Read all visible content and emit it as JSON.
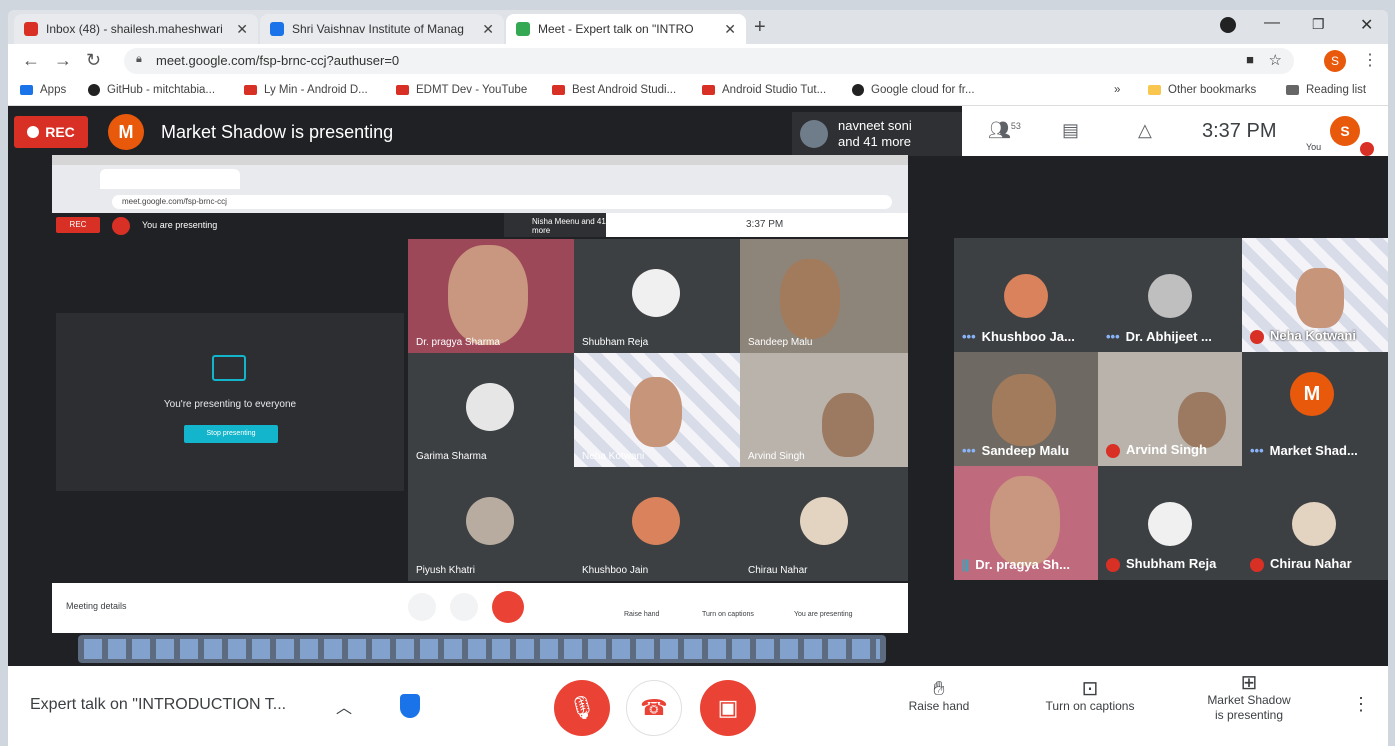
{
  "browser": {
    "tabs": [
      {
        "label": "Inbox (48) - shailesh.maheshwari",
        "color": "#d93025"
      },
      {
        "label": "Shri Vaishnav Institute of Manag",
        "color": "#1a73e8"
      },
      {
        "label": "Meet - Expert talk on \"INTRO",
        "color": "#34a853"
      }
    ],
    "url": "meet.google.com/fsp-brnc-ccj?authuser=0",
    "bookmarks": [
      "Apps",
      "GitHub - mitchtabia...",
      "Ly Min - Android D...",
      "EDMT Dev - YouTube",
      "Best Android Studi...",
      "Android Studio Tut...",
      "Google cloud for fr...",
      "Other bookmarks",
      "Reading list"
    ]
  },
  "meet": {
    "rec_label": "REC",
    "presenter_initial": "M",
    "presenting_title": "Market Shadow is presenting",
    "viewer_line1": "navneet soni",
    "viewer_line2": "and 41 more",
    "people_count": "53",
    "time": "3:37 PM",
    "you_label": "You",
    "you_initial": "S",
    "tiles": [
      {
        "name": "Khushboo Ja...",
        "muted": false
      },
      {
        "name": "Dr. Abhijeet ...",
        "muted": false
      },
      {
        "name": "Neha Kotwani",
        "muted": true
      },
      {
        "name": "Sandeep Malu",
        "muted": false
      },
      {
        "name": "Arvind Singh",
        "muted": true
      },
      {
        "name": "Market Shad...",
        "muted": false,
        "initial": "M"
      },
      {
        "name": "Dr. pragya Sh...",
        "muted": false
      },
      {
        "name": "Shubham Reja",
        "muted": true
      },
      {
        "name": "Chirau Nahar",
        "muted": true
      }
    ]
  },
  "inner": {
    "url": "meet.google.com/fsp-brnc-ccj",
    "rec_label": "REC",
    "presenting": "You are presenting",
    "viewer": "Nisha Meenu and 41 more",
    "time": "3:37 PM",
    "present_msg": "You're presenting to everyone",
    "stop_btn": "Stop presenting",
    "tiles": [
      "Dr. pragya Sharma",
      "Shubham Reja",
      "Sandeep Malu",
      "Garima Sharma",
      "Neha Kotwani",
      "Arvind Singh",
      "Piyush Khatri",
      "Khushboo Jain",
      "Chirau Nahar"
    ],
    "meeting_details": "Meeting details",
    "raise_hand": "Raise hand",
    "captions": "Turn on captions",
    "you_presenting": "You are presenting"
  },
  "bottom": {
    "meeting_title": "Expert talk on \"INTRODUCTION T...",
    "raise_hand": "Raise hand",
    "captions": "Turn on captions",
    "presenting_line1": "Market Shadow",
    "presenting_line2": "is presenting"
  },
  "colors": {
    "red": "#d93025",
    "orange_avatar": "#e8590c",
    "meet_bg": "#202124",
    "teal": "#12b5cb"
  }
}
